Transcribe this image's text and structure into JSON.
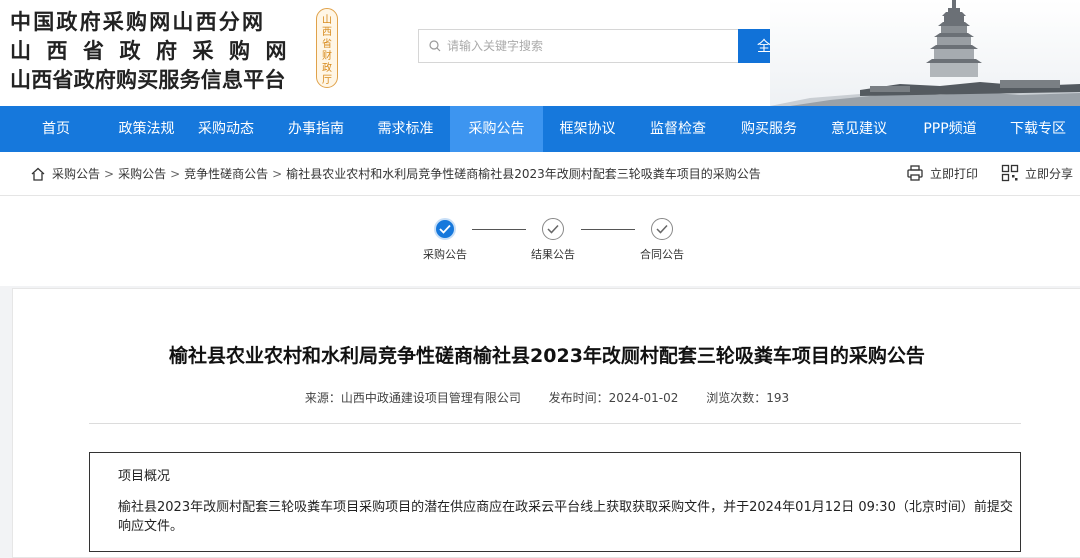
{
  "header": {
    "logo_lines": [
      "中国政府采购网山西分网",
      "山西省政府采购网",
      "山西省政府购买服务信息平台"
    ],
    "seal_text": "山西省财政厅",
    "search_placeholder": "请输入关键字搜索",
    "search_button": "全站搜索"
  },
  "nav": {
    "items": [
      {
        "label": "首页"
      },
      {
        "label": "政策法规"
      },
      {
        "label": "采购动态"
      },
      {
        "label": "办事指南"
      },
      {
        "label": "需求标准"
      },
      {
        "label": "采购公告",
        "active": true
      },
      {
        "label": "框架协议"
      },
      {
        "label": "监督检查"
      },
      {
        "label": "购买服务"
      },
      {
        "label": "意见建议"
      },
      {
        "label": "PPP频道"
      },
      {
        "label": "下载专区"
      }
    ]
  },
  "breadcrumb": {
    "items": [
      "采购公告",
      "采购公告",
      "竞争性磋商公告",
      "榆社县农业农村和水利局竞争性磋商榆社县2023年改厕村配套三轮吸粪车项目的采购公告"
    ],
    "separator": ">"
  },
  "tools": {
    "print_label": "立即打印",
    "share_label": "立即分享"
  },
  "steps": [
    {
      "label": "采购公告",
      "state": "active"
    },
    {
      "label": "结果公告",
      "state": "pending"
    },
    {
      "label": "合同公告",
      "state": "pending"
    }
  ],
  "article": {
    "title": "榆社县农业农村和水利局竞争性磋商榆社县2023年改厕村配套三轮吸粪车项目的采购公告",
    "source": "来源：山西中政通建设项目管理有限公司",
    "publish_time": "发布时间：2024-01-02",
    "views": "浏览次数：193",
    "section_heading": "项目概况",
    "paragraph": "榆社县2023年改厕村配套三轮吸粪车项目采购项目的潜在供应商应在政采云平台线上获取获取采购文件，并于2024年01月12日 09:30（北京时间）前提交响应文件。"
  },
  "colors": {
    "nav_bg": "#1678dc",
    "nav_active": "#3d95f0",
    "search_button": "#1172d8"
  }
}
